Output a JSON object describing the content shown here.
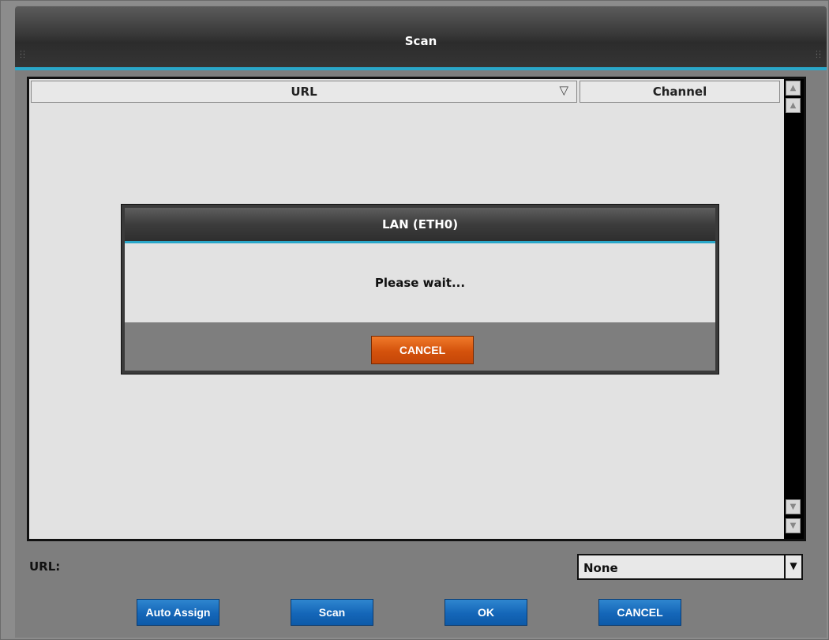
{
  "window": {
    "title": "Scan"
  },
  "list": {
    "columns": [
      {
        "label": "URL",
        "sort_icon": "▽"
      },
      {
        "label": "Channel"
      }
    ],
    "rows": []
  },
  "dialog": {
    "title": "LAN (ETH0)",
    "message": "Please wait...",
    "cancel_label": "CANCEL"
  },
  "url_field": {
    "label": "URL:",
    "selected": "None"
  },
  "buttons": {
    "auto_assign": "Auto Assign",
    "scan": "Scan",
    "ok": "OK",
    "cancel": "CANCEL"
  },
  "colors": {
    "accent": "#2aa7c9",
    "primary_button": "#1466b8",
    "dialog_cancel": "#d4520c"
  }
}
